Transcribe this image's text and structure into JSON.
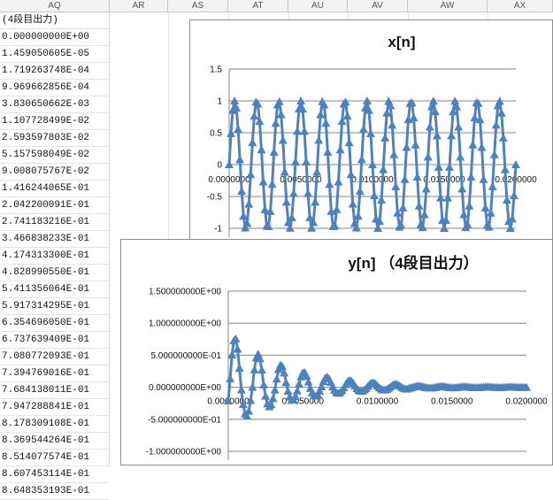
{
  "columns": [
    "AQ",
    "AR",
    "AS",
    "AT",
    "AU",
    "AV",
    "AW",
    "AX"
  ],
  "col_aq_values": [
    "(4段目出力)",
    "0.000000000E+00",
    "1.459050605E-05",
    "1.719263748E-04",
    "9.969662856E-04",
    "3.830650662E-03",
    "1.107728499E-02",
    "2.593597803E-02",
    "5.157598049E-02",
    "9.008075767E-02",
    "1.416244065E-01",
    "2.042200091E-01",
    "2.741183216E-01",
    "3.466838233E-01",
    "4.174313300E-01",
    "4.828990550E-01",
    "5.411356064E-01",
    "5.917314295E-01",
    "6.354696050E-01",
    "6.737639409E-01",
    "7.080772093E-01",
    "7.394769016E-01",
    "7.684138011E-01",
    "7.947288841E-01",
    "8.178309108E-01",
    "8.369544264E-01",
    "8.514077574E-01",
    "8.607453114E-01",
    "8.648353193E-01"
  ],
  "accent_color": "#4f81bd",
  "chart_data": [
    {
      "type": "line",
      "title": "x[n]",
      "x_range": [
        0,
        0.02
      ],
      "ylim": [
        -1,
        1.5
      ],
      "y_ticks": [
        "1.5",
        "1",
        "0.5",
        "0",
        "-0.5",
        "-1"
      ],
      "y_tick_values": [
        1.5,
        1,
        0.5,
        0,
        -0.5,
        -1
      ],
      "x_ticks": [
        "0.0000000",
        "0.0050000",
        "0.0100000",
        "0.0150000",
        "0.0200000"
      ],
      "x_tick_values": [
        0,
        0.005,
        0.01,
        0.015,
        0.02
      ],
      "series": [
        {
          "amplitude": 1,
          "cycles": 13,
          "marker": "triangle"
        }
      ]
    },
    {
      "type": "line",
      "title": "y[n] （4段目出力）",
      "x_range": [
        0,
        0.02
      ],
      "ylim": [
        -1,
        1.5
      ],
      "y_ticks": [
        "1.500000000E+00",
        "1.000000000E+00",
        "5.000000000E-01",
        "0.000000000E+00",
        "-5.000000000E-01",
        "-1.000000000E+00"
      ],
      "y_tick_values": [
        1.5,
        1,
        0.5,
        0,
        -0.5,
        -1
      ],
      "x_ticks": [
        "0.0000000",
        "0.0050000",
        "0.0100000",
        "0.0150000",
        "0.0200000"
      ],
      "x_tick_values": [
        0,
        0.005,
        0.01,
        0.015,
        0.02
      ],
      "series": [
        {
          "peak": 0.865,
          "trough": -0.62,
          "cycles": 13,
          "marker": "triangle"
        }
      ]
    }
  ]
}
